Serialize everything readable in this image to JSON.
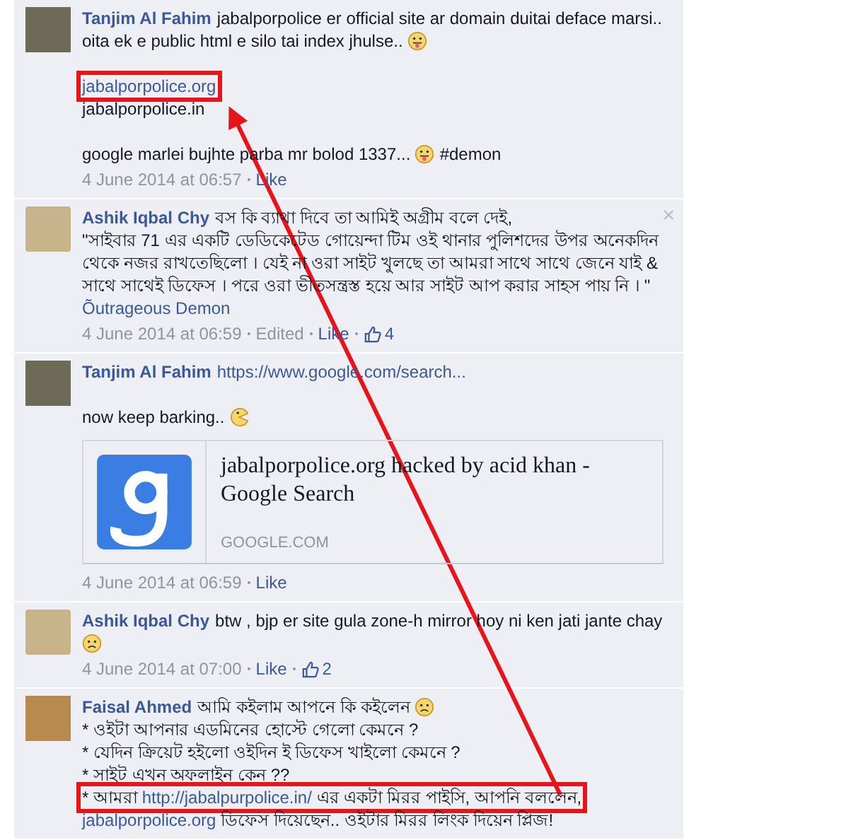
{
  "comments": [
    {
      "author": "Tanjim Al Fahim",
      "avatar": {
        "kind": "photo"
      },
      "paragraphs": [
        {
          "segments": [
            {
              "kind": "text",
              "text": "jabalporpolice er official site ar domain duitai deface marsi.. oita ek e public html e silo tai index jhulse.. "
            },
            {
              "kind": "emoji_tongue"
            }
          ]
        },
        {
          "gap": true,
          "segments": [
            {
              "kind": "link",
              "text": "jabalporpolice.org",
              "boxed": true
            }
          ]
        },
        {
          "segments": [
            {
              "kind": "text",
              "text": "jabalporpolice.in"
            }
          ]
        },
        {
          "gap": true,
          "segments": [
            {
              "kind": "text",
              "text": "google marlei bujhte parba mr bolod 1337... "
            },
            {
              "kind": "emoji_tongue"
            },
            {
              "kind": "text",
              "text": " #demon"
            }
          ]
        }
      ],
      "meta": [
        {
          "kind": "text",
          "text": "4 June 2014 at 06:57"
        },
        {
          "kind": "link",
          "text": "Like"
        }
      ]
    },
    {
      "author": "Ashik Iqbal Chy",
      "avatar": {
        "kind": "cartoon"
      },
      "close": "×",
      "paragraphs": [
        {
          "segments": [
            {
              "kind": "text",
              "text": "বস কি ব্যাথা দিবে তা আমিই অগ্রীম বলে দেই,"
            }
          ]
        },
        {
          "segments": [
            {
              "kind": "text",
              "text": "\"সাইবার 71 এর একটি ডেডিকেটেড গোয়েন্দা টিম ওই থানার পুলিশদের উপর অনেকদিন থেকে নজর রাখতেছিলো । যেই না ওরা সাইট খুলছে তা আমরা সাথে সাথে জেনে যাই & সাথে সাথেই ডিফেস । পরে ওরা ভীতসন্ত্রস্ত হয়ে আর সাইট আপ করার সাহস পায় নি । \" "
            },
            {
              "kind": "link",
              "text": "Õutrageous Demon"
            }
          ]
        }
      ],
      "meta": [
        {
          "kind": "text",
          "text": "4 June 2014 at 06:59"
        },
        {
          "kind": "text",
          "text": "Edited"
        },
        {
          "kind": "link",
          "text": "Like"
        },
        {
          "kind": "likes",
          "text": "4"
        }
      ]
    },
    {
      "author": "Tanjim Al Fahim",
      "avatar": {
        "kind": "photo"
      },
      "paragraphs": [
        {
          "segments": [
            {
              "kind": "link",
              "text": "https://www.google.com/search..."
            }
          ]
        },
        {
          "gap": true,
          "segments": [
            {
              "kind": "text",
              "text": "now keep barking.. "
            },
            {
              "kind": "emoji_grin"
            }
          ]
        }
      ],
      "preview": {
        "title": "jabalporpolice.org hacked by acid khan - Google Search",
        "domain": "GOOGLE.COM"
      },
      "meta": [
        {
          "kind": "text",
          "text": "4 June 2014 at 06:59"
        },
        {
          "kind": "link",
          "text": "Like"
        }
      ]
    },
    {
      "author": "Ashik Iqbal Chy",
      "avatar": {
        "kind": "cartoon"
      },
      "paragraphs": [
        {
          "segments": [
            {
              "kind": "text",
              "text": "btw , bjp er site gula zone-h mirror hoy ni ken jati jante chay "
            },
            {
              "kind": "emoji_frown"
            }
          ]
        }
      ],
      "meta": [
        {
          "kind": "text",
          "text": "4 June 2014 at 07:00"
        },
        {
          "kind": "link",
          "text": "Like"
        },
        {
          "kind": "likes",
          "text": "2"
        }
      ]
    },
    {
      "author": "Faisal Ahmed",
      "avatar": {
        "kind": "calligraphy"
      },
      "paragraphs": [
        {
          "segments": [
            {
              "kind": "text",
              "text": "আমি কইলাম আপনে কি কইলেন "
            },
            {
              "kind": "emoji_frown"
            }
          ]
        },
        {
          "segments": [
            {
              "kind": "text",
              "text": "* ওইটা আপনার এডমিনের হোস্টে গেলো কেমনে ?"
            }
          ]
        },
        {
          "segments": [
            {
              "kind": "text",
              "text": "* যেদিন ক্রিয়েট হইলো ওইদিন ই ডিফেস খাইলো কেমনে ?"
            }
          ]
        },
        {
          "segments": [
            {
              "kind": "text",
              "text": "* সাইট এখন অফলাইন কেন ??"
            }
          ]
        },
        {
          "segments": [
            {
              "kind": "text",
              "text": "* আমরা ",
              "boxed": true
            },
            {
              "kind": "link",
              "text": "http://jabalpurpolice.in/",
              "boxed": true
            },
            {
              "kind": "text",
              "text": " এর একটা মিরর পাইসি, আপনি বললেন,",
              "boxed": true
            }
          ]
        },
        {
          "segments": [
            {
              "kind": "link",
              "text": "jabalporpolice.org"
            },
            {
              "kind": "text",
              "text": " ডিফেস দিয়েছেন.. ওইটার মিরর লিংক দিয়েন প্লিজ!"
            }
          ]
        }
      ]
    }
  ]
}
